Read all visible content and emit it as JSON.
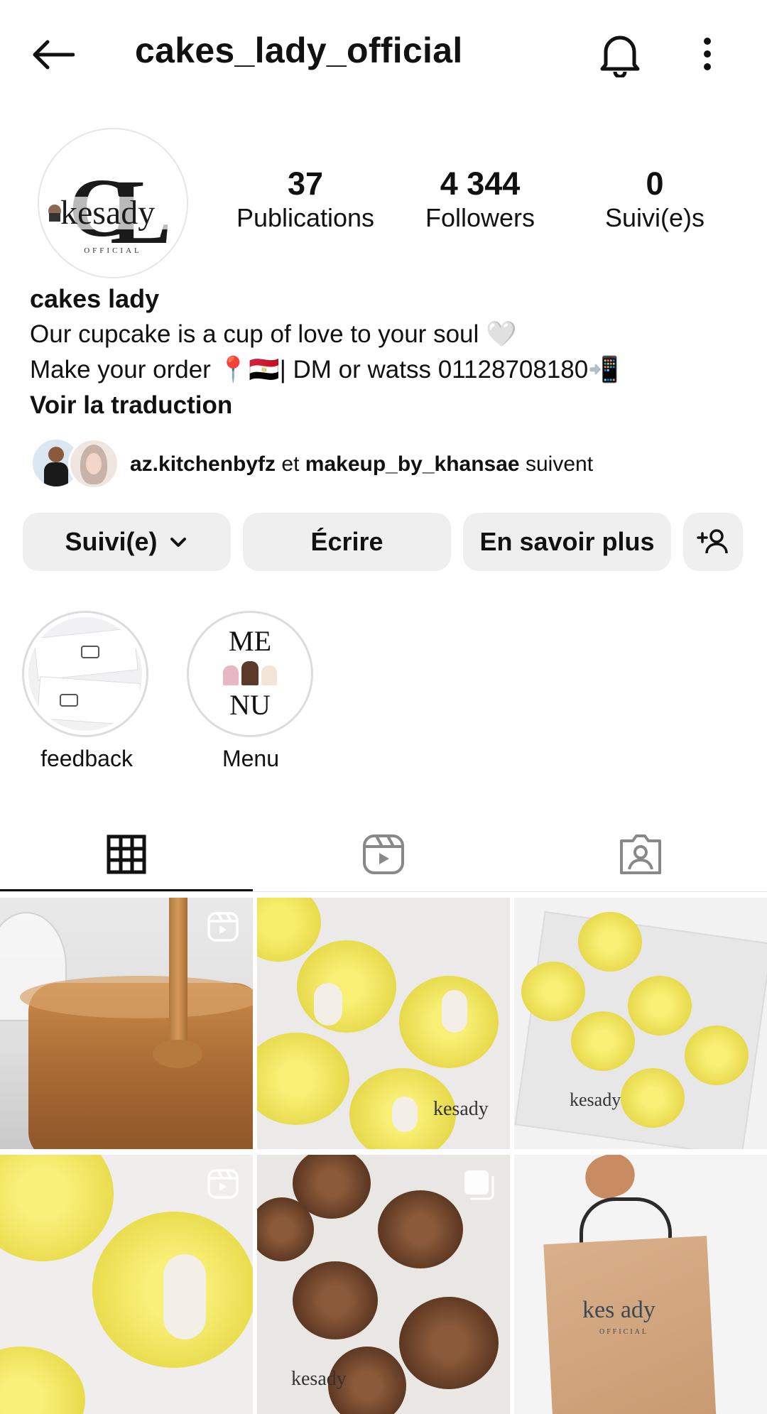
{
  "header": {
    "username": "cakes_lady_official"
  },
  "profile": {
    "avatar_text_main": "CL kesady",
    "avatar_text_sub": "OFFICIAL",
    "stats": [
      {
        "value": "37",
        "label": "Publications"
      },
      {
        "value": "4 344",
        "label": "Followers"
      },
      {
        "value": "0",
        "label": "Suivi(e)s"
      }
    ],
    "name": "cakes lady",
    "bio_line1": "Our cupcake is a cup of love to your soul 🤍",
    "bio_line2": "Make your order 📍🇪🇬| DM or watss 01128708180📲",
    "translate": "Voir la traduction",
    "mutual_user1": "az.kitchenbyfz",
    "mutual_and": "et",
    "mutual_user2": "makeup_by_khansae",
    "mutual_suffix": "suivent"
  },
  "actions": {
    "following": "Suivi(e)",
    "message": "Écrire",
    "more_info": "En savoir plus"
  },
  "highlights": [
    {
      "label": "feedback",
      "cover_text": ""
    },
    {
      "label": "Menu",
      "cover_top": "ME",
      "cover_bottom": "NU"
    }
  ],
  "tabs": [
    "grid-icon",
    "reels-icon",
    "tagged-icon"
  ],
  "grid": {
    "watermark": "kesady",
    "bag_logo": "kes ady",
    "bag_sub": "OFFICIAL"
  }
}
